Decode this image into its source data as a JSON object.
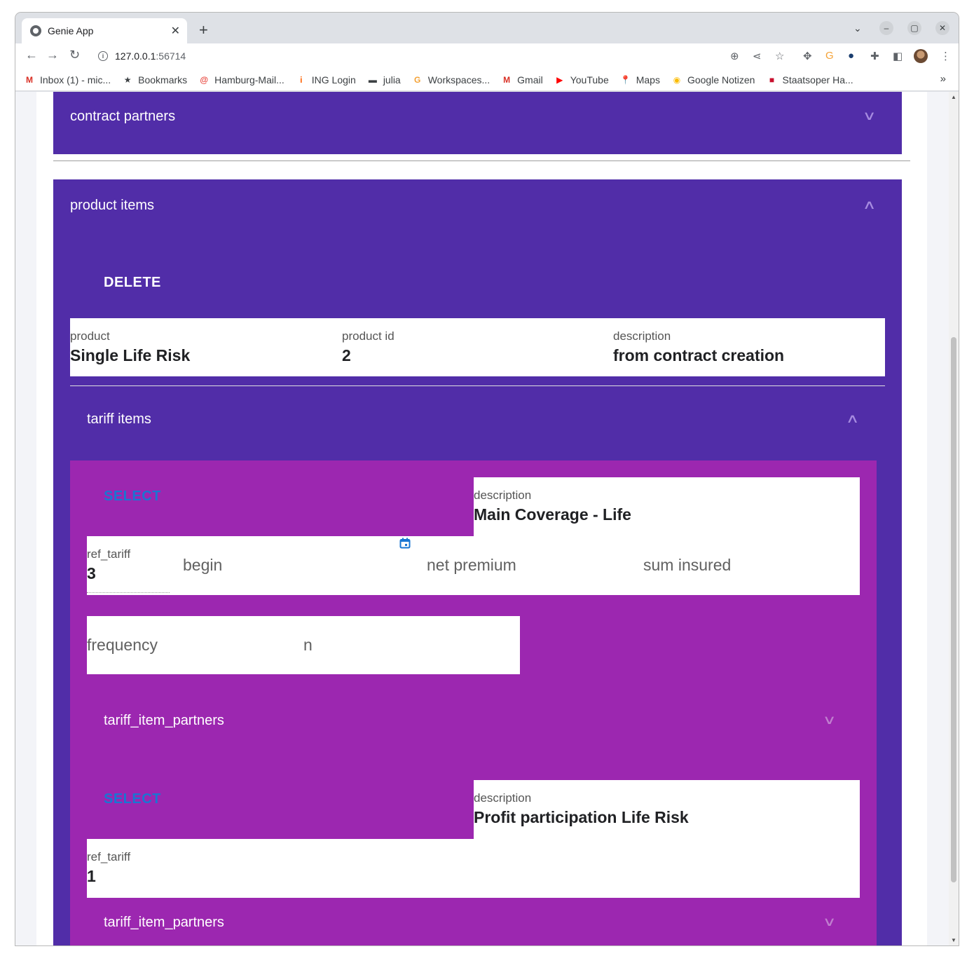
{
  "browser": {
    "tab_title": "Genie App",
    "tab_close": "✕",
    "new_tab": "+",
    "url_host": "127.0.0.1",
    "url_port": ":56714",
    "bookmarks": [
      {
        "label": "Inbox (1) - mic...",
        "icon": "gmail-icon",
        "color": "#d93025",
        "glyph": "M"
      },
      {
        "label": "Bookmarks",
        "icon": "star-icon",
        "color": "#3c4043",
        "glyph": "★"
      },
      {
        "label": "Hamburg-Mail...",
        "icon": "mail-icon",
        "color": "#e8453c",
        "glyph": "@"
      },
      {
        "label": "ING Login",
        "icon": "ing-icon",
        "color": "#ff6200",
        "glyph": "i"
      },
      {
        "label": "julia",
        "icon": "folder-icon",
        "color": "#3c4043",
        "glyph": "▬"
      },
      {
        "label": "Workspaces...",
        "icon": "workspaces-icon",
        "color": "#f4a236",
        "glyph": "G"
      },
      {
        "label": "Gmail",
        "icon": "gmail-icon",
        "color": "#d93025",
        "glyph": "M"
      },
      {
        "label": "YouTube",
        "icon": "youtube-icon",
        "color": "#ff0000",
        "glyph": "▶"
      },
      {
        "label": "Maps",
        "icon": "maps-icon",
        "color": "#34a853",
        "glyph": "📍"
      },
      {
        "label": "Google Notizen",
        "icon": "keep-icon",
        "color": "#fbbc04",
        "glyph": "◉"
      },
      {
        "label": "Staatsoper Ha...",
        "icon": "staatsoper-icon",
        "color": "#c8102e",
        "glyph": "■"
      }
    ],
    "bookmarks_more": "»"
  },
  "app": {
    "contract_partners_header": "contract partners",
    "product_items_header": "product items",
    "delete_label": "DELETE",
    "product": {
      "product_label": "product",
      "product_value": "Single Life Risk",
      "product_id_label": "product id",
      "product_id_value": "2",
      "description_label": "description",
      "description_value": "from contract creation"
    },
    "tariff_items_header": "tariff items",
    "tariff_items": [
      {
        "select_label": "SELECT",
        "description_label": "description",
        "description_value": "Main Coverage - Life",
        "ref_tariff_label": "ref_tariff",
        "ref_tariff_value": "3",
        "begin_placeholder": "begin",
        "net_premium_placeholder": "net premium",
        "sum_insured_placeholder": "sum insured",
        "frequency_placeholder": "frequency",
        "n_placeholder": "n",
        "partners_header": "tariff_item_partners"
      },
      {
        "select_label": "SELECT",
        "description_label": "description",
        "description_value": "Profit participation Life Risk",
        "ref_tariff_label": "ref_tariff",
        "ref_tariff_value": "1",
        "partners_header": "tariff_item_partners"
      }
    ]
  },
  "colors": {
    "primary": "#512da8",
    "secondary": "#9c27b0",
    "select_text": "#1976d2"
  }
}
